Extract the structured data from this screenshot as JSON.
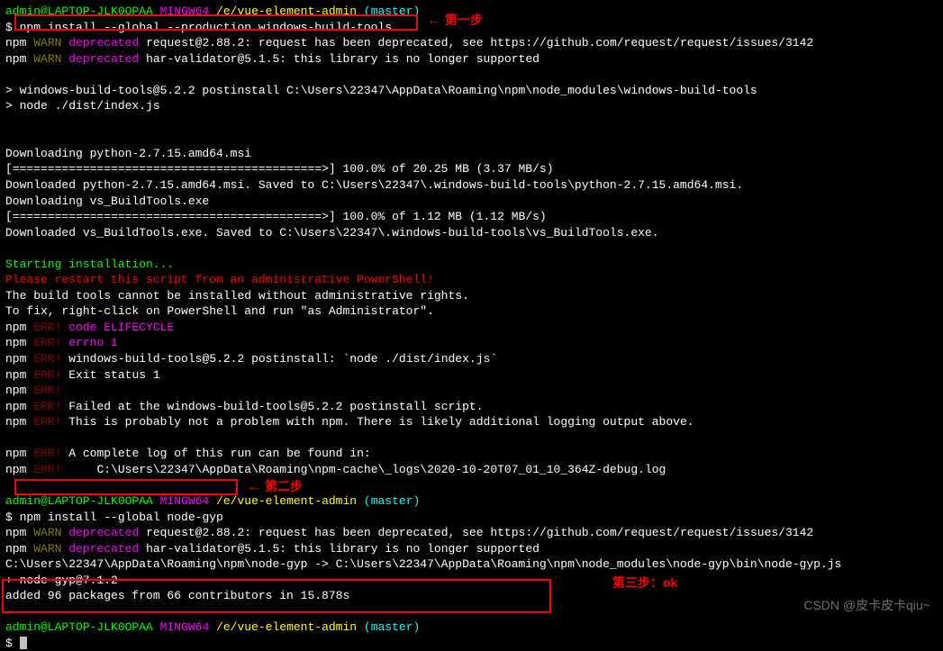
{
  "prompt1": {
    "user": "admin@LAPTOP-JLK0OPAA",
    "env": "MINGW64",
    "path": "/e/vue-element-admin",
    "branch": "(master)"
  },
  "cmd1": "npm install --global --production windows-build-tools",
  "warn1": {
    "npm": "npm ",
    "tag": "WARN",
    "dep": " deprecated",
    "msg1": " request@2.88.2: request has been deprecated, see https://github.com/request/request/issues/3142",
    "msg2": " har-validator@5.1.5: this library is no longer supported"
  },
  "post1": "> windows-build-tools@5.2.2 postinstall C:\\Users\\22347\\AppData\\Roaming\\npm\\node_modules\\windows-build-tools",
  "post2": "> node ./dist/index.js",
  "dl1": "Downloading python-2.7.15.amd64.msi",
  "dl1bar": "[============================================>] 100.0% of 20.25 MB (3.37 MB/s)",
  "dl1done": "Downloaded python-2.7.15.amd64.msi. Saved to C:\\Users\\22347\\.windows-build-tools\\python-2.7.15.amd64.msi.",
  "dl2": "Downloading vs_BuildTools.exe",
  "dl2bar": "[============================================>] 100.0% of 1.12 MB (1.12 MB/s)",
  "dl2done": "Downloaded vs_BuildTools.exe. Saved to C:\\Users\\22347\\.windows-build-tools\\vs_BuildTools.exe.",
  "start": "Starting installation...",
  "restart": "Please restart this script from an administrative PowerShell!",
  "adm1": "The build tools cannot be installed without administrative rights.",
  "adm2": "To fix, right-click on PowerShell and run \"as Administrator\".",
  "errs": {
    "npm": "npm ",
    "tag": "ERR!",
    "l1": " code ELIFECYCLE",
    "l2": " errno 1",
    "l3": " windows-build-tools@5.2.2 postinstall: `node ./dist/index.js`",
    "l4": " Exit status 1",
    "l5": "",
    "l6": " Failed at the windows-build-tools@5.2.2 postinstall script.",
    "l7": " This is probably not a problem with npm. There is likely additional logging output above.",
    "l8": " A complete log of this run can be found in:",
    "l9": "     C:\\Users\\22347\\AppData\\Roaming\\npm-cache\\_logs\\2020-10-20T07_01_10_364Z-debug.log"
  },
  "cmd2": "npm install --global node-gyp",
  "gyp1": "C:\\Users\\22347\\AppData\\Roaming\\npm\\node-gyp -> C:\\Users\\22347\\AppData\\Roaming\\npm\\node_modules\\node-gyp\\bin\\node-gyp.js",
  "gyp2": "+ node-gyp@7.1.2",
  "gyp3": "added 96 packages from 66 contributors in 15.878s",
  "ann1": "第一步",
  "ann2": "第二步",
  "ann3": "第三步：ok",
  "watermark": "CSDN @皮卡皮卡qiu~",
  "dollar": "$ "
}
